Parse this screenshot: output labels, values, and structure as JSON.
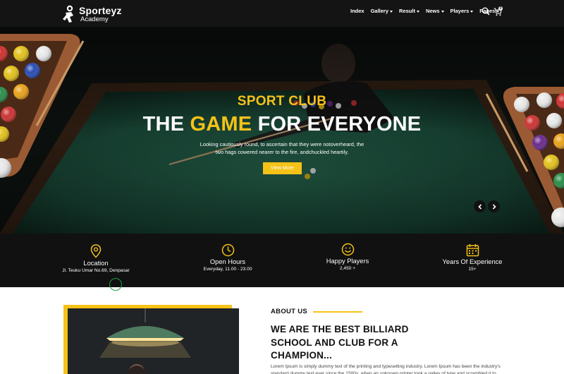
{
  "brand": {
    "name": "Sporteyz",
    "sub": "Academy",
    "logo_icon": "runner-icon"
  },
  "nav": {
    "items": [
      {
        "label": "Index",
        "dropdown": false
      },
      {
        "label": "Gallery",
        "dropdown": true
      },
      {
        "label": "Result",
        "dropdown": true
      },
      {
        "label": "News",
        "dropdown": true
      },
      {
        "label": "Players",
        "dropdown": true
      },
      {
        "label": "Pages",
        "dropdown": true
      }
    ],
    "search_icon": "search-icon",
    "cart_icon": "cart-icon",
    "cart_count": "0"
  },
  "hero": {
    "subtitle": "SPORT CLUB",
    "title_pre": "THE",
    "title_highlight": "GAME",
    "title_post": "FOR EVERYONE",
    "description": "Looking cautiously round, to ascertain that they were notoverheard, the two hags cowered nearer to the fire, andchuckled heartily.",
    "cta_label": "View More",
    "prev_icon": "chevron-left-icon",
    "next_icon": "chevron-right-icon"
  },
  "features": [
    {
      "title": "Location",
      "value": "Jl. Teuku Umar No.69, Denpasar",
      "icon": "map-pin-icon"
    },
    {
      "title": "Open Hours",
      "value": "Everyday, 11.00 - 23.00",
      "icon": "clock-icon"
    },
    {
      "title": "Happy Players",
      "value": "2,450 +",
      "icon": "smile-icon"
    },
    {
      "title": "Years Of Experience",
      "value": "15+",
      "icon": "calendar-icon"
    }
  ],
  "about": {
    "label": "ABOUT US",
    "heading": "WE ARE THE BEST BILLIARD SCHOOL AND CLUB FOR A CHAMPION...",
    "text": "Lorem Ipsum is simply dummy text of the printing and typesetting industry. Lorem Ipsum has been the industry's standard dummy text ever since the 1500s, when an unknown printer took a galley of type and scrambled it to"
  },
  "colors": {
    "accent": "#f5c218",
    "dark": "#111111",
    "felt": "#1f5a44"
  }
}
